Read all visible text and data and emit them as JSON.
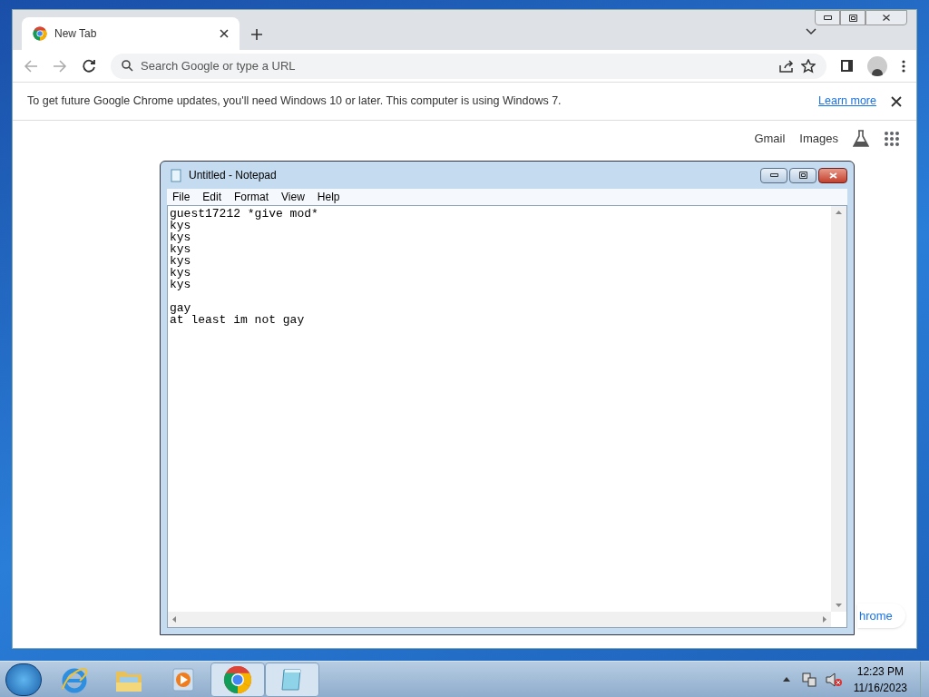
{
  "chrome": {
    "tab": {
      "title": "New Tab",
      "selected": true
    },
    "omnibox": {
      "placeholder": "Search Google or type a URL"
    },
    "infobar": {
      "message": "To get future Google Chrome updates, you'll need Windows 10 or later. This computer is using Windows 7.",
      "link": "Learn more"
    },
    "top_links": [
      "Gmail",
      "Images"
    ],
    "partial_button": "hrome"
  },
  "notepad": {
    "title": "Untitled - Notepad",
    "menu": [
      "File",
      "Edit",
      "Format",
      "View",
      "Help"
    ],
    "text": "guest17212 *give mod*\nkys\nkys\nkys\nkys\nkys\nkys\n\ngay\nat least im not gay"
  },
  "taskbar": {
    "items": [
      {
        "kind": "ie",
        "running": false
      },
      {
        "kind": "folder",
        "running": false
      },
      {
        "kind": "media",
        "running": false
      },
      {
        "kind": "chrome",
        "running": true
      },
      {
        "kind": "notepad",
        "running": true
      }
    ],
    "time": "12:23 PM",
    "date": "11/16/2023"
  }
}
